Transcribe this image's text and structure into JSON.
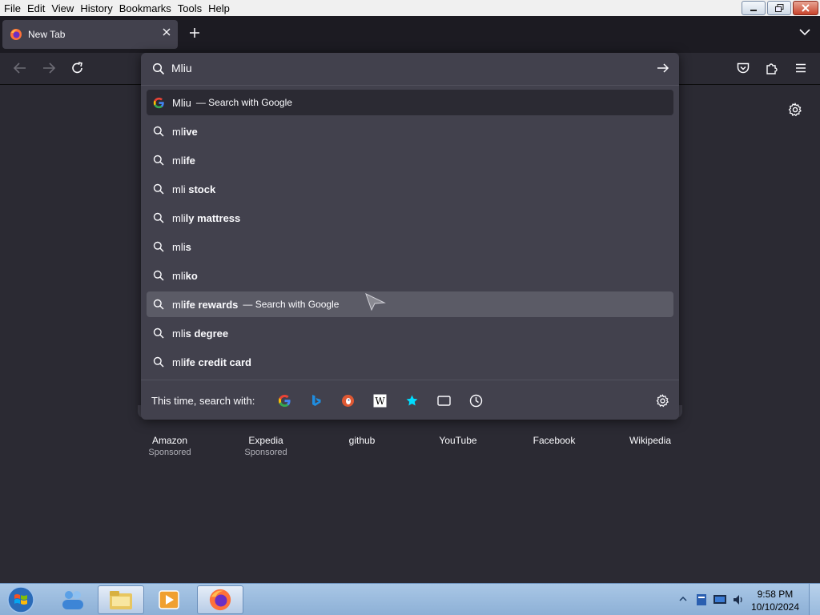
{
  "menu": {
    "items": [
      "File",
      "Edit",
      "View",
      "History",
      "Bookmarks",
      "Tools",
      "Help"
    ]
  },
  "tab": {
    "title": "New Tab",
    "close": "✕",
    "new_tab": "+"
  },
  "urlbar": {
    "value": "Mliu",
    "results": [
      {
        "prefix": "Mliu",
        "suffix": "",
        "action": "— Search with Google",
        "icon": "google-icon",
        "state": "selected"
      },
      {
        "prefix": "ml",
        "suffix": "ive",
        "action": "",
        "icon": "search-icon",
        "state": ""
      },
      {
        "prefix": "ml",
        "suffix": "ife",
        "action": "",
        "icon": "search-icon",
        "state": ""
      },
      {
        "prefix": "mli ",
        "suffix": "stock",
        "action": "",
        "icon": "search-icon",
        "state": ""
      },
      {
        "prefix": "mli",
        "suffix": "ly mattress",
        "action": "",
        "icon": "search-icon",
        "state": ""
      },
      {
        "prefix": "mli",
        "suffix": "s",
        "action": "",
        "icon": "search-icon",
        "state": ""
      },
      {
        "prefix": "mli",
        "suffix": "ko",
        "action": "",
        "icon": "search-icon",
        "state": ""
      },
      {
        "prefix": "ml",
        "suffix": "ife rewards",
        "action": "— Search with Google",
        "icon": "search-icon",
        "state": "hover"
      },
      {
        "prefix": "mli",
        "suffix": "s degree",
        "action": "",
        "icon": "search-icon",
        "state": ""
      },
      {
        "prefix": "ml",
        "suffix": "ife credit card",
        "action": "",
        "icon": "search-icon",
        "state": ""
      }
    ],
    "oneoff_label": "This time, search with:",
    "engines": [
      "google-icon",
      "bing-icon",
      "duckduckgo-icon",
      "wikipedia-icon",
      "bookmarks-star-icon",
      "tabs-icon",
      "history-clock-icon"
    ]
  },
  "tiles": [
    {
      "name": "Amazon",
      "sponsored": "Sponsored"
    },
    {
      "name": "Expedia",
      "sponsored": "Sponsored"
    },
    {
      "name": "github",
      "sponsored": ""
    },
    {
      "name": "YouTube",
      "sponsored": ""
    },
    {
      "name": "Facebook",
      "sponsored": ""
    },
    {
      "name": "Wikipedia",
      "sponsored": ""
    }
  ],
  "taskbar": {
    "time": "9:58 PM",
    "date": "10/10/2024"
  },
  "colors": {
    "accent": "#00ddff",
    "panel": "#42414d",
    "bg": "#2b2a33"
  }
}
